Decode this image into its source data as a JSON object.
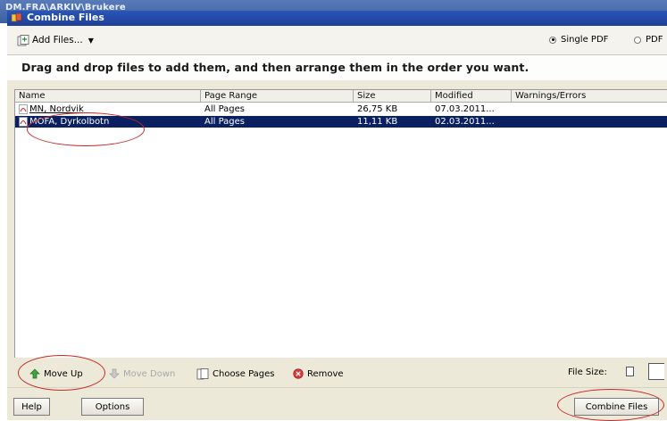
{
  "background_path": "DM.FRA\\ARKIV\\Brukere",
  "window": {
    "title": "Combine Files"
  },
  "toolbar": {
    "add_files": "Add Files...",
    "options": [
      {
        "label": "Single PDF",
        "selected": true
      },
      {
        "label": "PDF",
        "selected": false
      }
    ]
  },
  "instruction": "Drag and drop files to add them, and then arrange them in the order you want.",
  "table": {
    "columns": [
      "Name",
      "Page Range",
      "Size",
      "Modified",
      "Warnings/Errors"
    ],
    "rows": [
      {
        "name": "MN, Nordvik",
        "page_range": "All Pages",
        "size": "26,75 KB",
        "modified": "07.03.2011...",
        "warnings": "",
        "selected": false
      },
      {
        "name": "MOFA, Dyrkolbotn",
        "page_range": "All Pages",
        "size": "11,11 KB",
        "modified": "02.03.2011...",
        "warnings": "",
        "selected": true
      }
    ]
  },
  "actions": {
    "move_up": "Move Up",
    "move_down": "Move Down",
    "choose_pages": "Choose Pages",
    "remove": "Remove",
    "file_size_label": "File Size:"
  },
  "footer": {
    "help": "Help",
    "options": "Options",
    "combine": "Combine Files"
  },
  "colors": {
    "selection": "#0a2060",
    "title_bar": "#2a55b8",
    "annotation": "#c62828"
  }
}
